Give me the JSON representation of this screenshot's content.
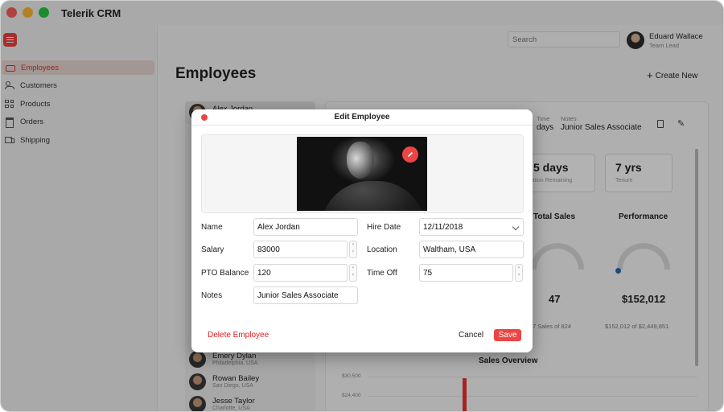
{
  "app": {
    "title": "Telerik CRM"
  },
  "sidebar": {
    "items": [
      {
        "label": "Employees",
        "icon": "employees-icon"
      },
      {
        "label": "Customers",
        "icon": "customers-icon"
      },
      {
        "label": "Products",
        "icon": "products-icon"
      },
      {
        "label": "Orders",
        "icon": "orders-icon"
      },
      {
        "label": "Shipping",
        "icon": "shipping-icon"
      }
    ]
  },
  "header": {
    "search_placeholder": "Search",
    "user_name": "Eduard Wallace",
    "user_role": "Team Lead"
  },
  "page": {
    "title": "Employees",
    "create_new": "Create New"
  },
  "employees": [
    {
      "name": "Alex Jordan",
      "location": ""
    },
    {
      "name": "Emery Dylan",
      "location": "Philadelphia, USA"
    },
    {
      "name": "Rowan Bailey",
      "location": "San Diego, USA"
    },
    {
      "name": "Jesse Taylor",
      "location": "Charlotte, USA"
    }
  ],
  "detail": {
    "time_label": "Time",
    "time_value": "days",
    "notes_label": "Notes",
    "notes_value": "Junior Sales Associate",
    "stats": [
      {
        "value": "5 days",
        "label": "cation Remaining"
      },
      {
        "value": "7 yrs",
        "label": "Tenure"
      }
    ],
    "gauges": [
      {
        "title": "Total Sales",
        "value": "47",
        "sub": "7 Sales of 824"
      },
      {
        "title": "Performance",
        "value": "$152,012",
        "sub": "$152,012 of $2,449,851"
      }
    ],
    "chart": {
      "title": "Sales Overview",
      "ticks": [
        "$30,500",
        "$24,400"
      ]
    }
  },
  "modal": {
    "title": "Edit Employee",
    "fields": {
      "name": {
        "label": "Name",
        "value": "Alex Jordan"
      },
      "hire_date": {
        "label": "Hire Date",
        "value": "12/11/2018"
      },
      "salary": {
        "label": "Salary",
        "value": "83000"
      },
      "location": {
        "label": "Location",
        "value": "Waltham, USA"
      },
      "pto_balance": {
        "label": "PTO Balance",
        "value": "120"
      },
      "time_off": {
        "label": "Time Off",
        "value": "75"
      },
      "notes": {
        "label": "Notes",
        "value": "Junior Sales Associate"
      }
    },
    "delete_label": "Delete Employee",
    "cancel_label": "Cancel",
    "save_label": "Save"
  },
  "colors": {
    "accent": "#ef4444",
    "overlay": "rgba(0,0,0,0.30)"
  }
}
